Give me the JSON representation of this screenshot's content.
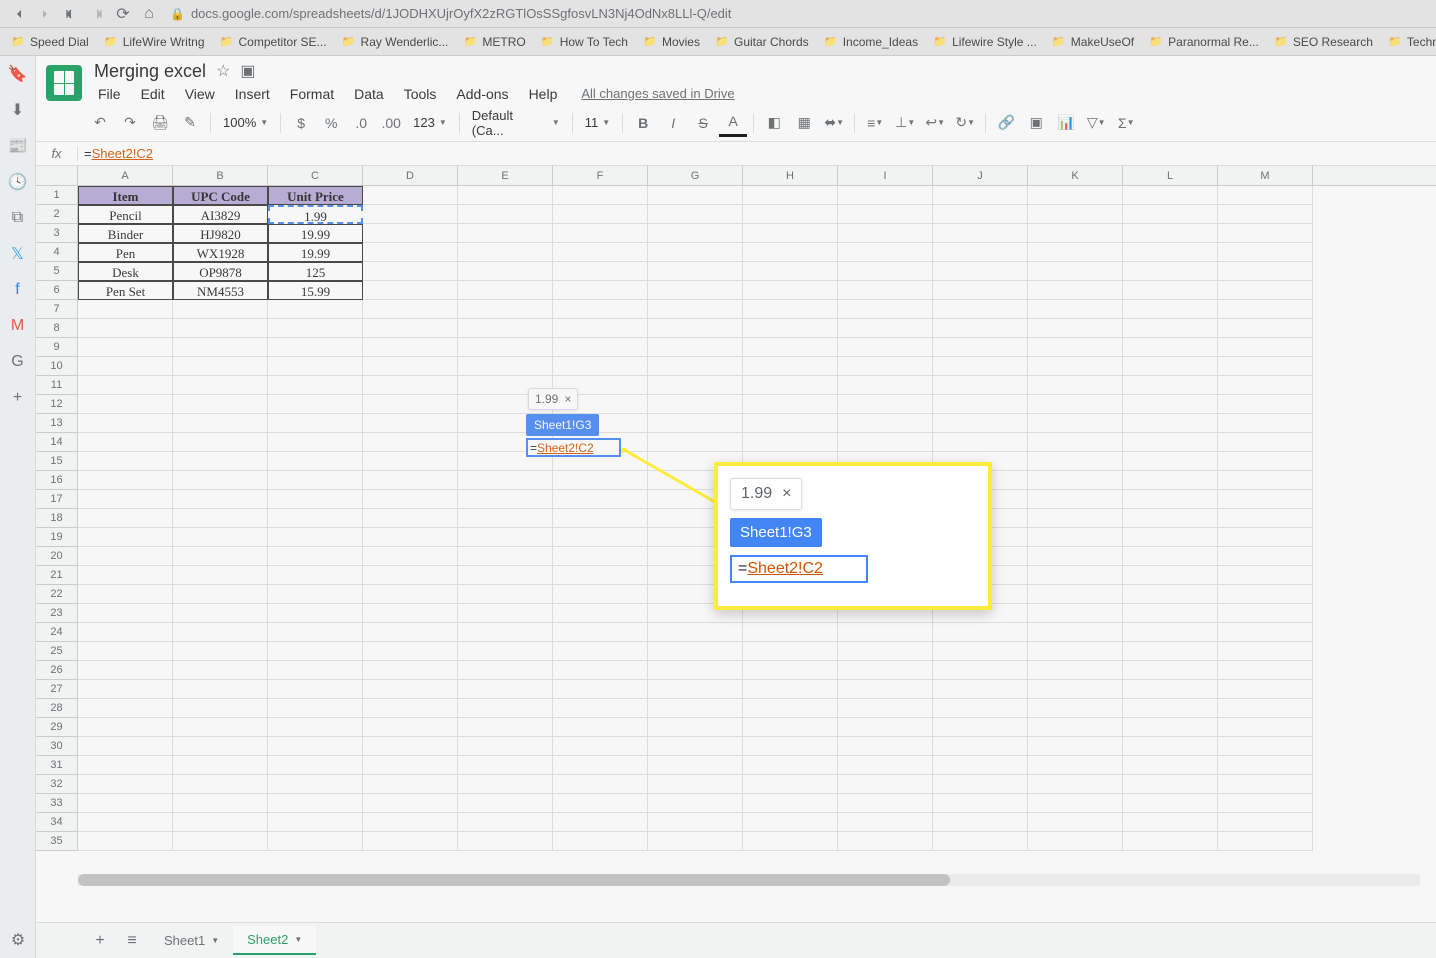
{
  "browser": {
    "url": "docs.google.com/spreadsheets/d/1JODHXUjrOyfX2zRGTlOsSSgfosvLN3Nj4OdNx8LLl-Q/edit"
  },
  "bookmarks": [
    {
      "label": "Speed Dial"
    },
    {
      "label": "LifeWire Writng"
    },
    {
      "label": "Competitor SE..."
    },
    {
      "label": "Ray Wenderlic..."
    },
    {
      "label": "METRO"
    },
    {
      "label": "How To Tech"
    },
    {
      "label": "Movies"
    },
    {
      "label": "Guitar Chords"
    },
    {
      "label": "Income_Ideas"
    },
    {
      "label": "Lifewire Style ..."
    },
    {
      "label": "MakeUseOf"
    },
    {
      "label": "Paranormal Re..."
    },
    {
      "label": "SEO Research"
    },
    {
      "label": "Technology"
    }
  ],
  "doc": {
    "title": "Merging excel",
    "save_status": "All changes saved in Drive"
  },
  "menu": [
    "File",
    "Edit",
    "View",
    "Insert",
    "Format",
    "Data",
    "Tools",
    "Add-ons",
    "Help"
  ],
  "toolbar": {
    "zoom": "100%",
    "font": "Default (Ca...",
    "font_size": "11",
    "number_format": "123"
  },
  "formula": {
    "prefix": "=",
    "ref": "Sheet2!C2"
  },
  "columns": [
    "A",
    "B",
    "C",
    "D",
    "E",
    "F",
    "G",
    "H",
    "I",
    "J",
    "K",
    "L",
    "M"
  ],
  "rows": 35,
  "data": {
    "headers": [
      "Item",
      "UPC Code",
      "Unit Price"
    ],
    "rows": [
      [
        "Pencil",
        "AI3829",
        "1.99"
      ],
      [
        "Binder",
        "HJ9820",
        "19.99"
      ],
      [
        "Pen",
        "WX1928",
        "19.99"
      ],
      [
        "Desk",
        "OP9878",
        "125"
      ],
      [
        "Pen Set",
        "NM4553",
        "15.99"
      ]
    ]
  },
  "annotation": {
    "tooltip_value": "1.99",
    "tooltip_close": "×",
    "cell_label": "Sheet1!G3",
    "formula_prefix": "=",
    "formula_ref": "Sheet2!C2"
  },
  "callout": {
    "tooltip_value": "1.99",
    "tooltip_close": "×",
    "cell_label": "Sheet1!G3",
    "formula_prefix": "=",
    "formula_ref": "Sheet2!C2"
  },
  "sheets": [
    {
      "name": "Sheet1",
      "active": false
    },
    {
      "name": "Sheet2",
      "active": true
    }
  ]
}
